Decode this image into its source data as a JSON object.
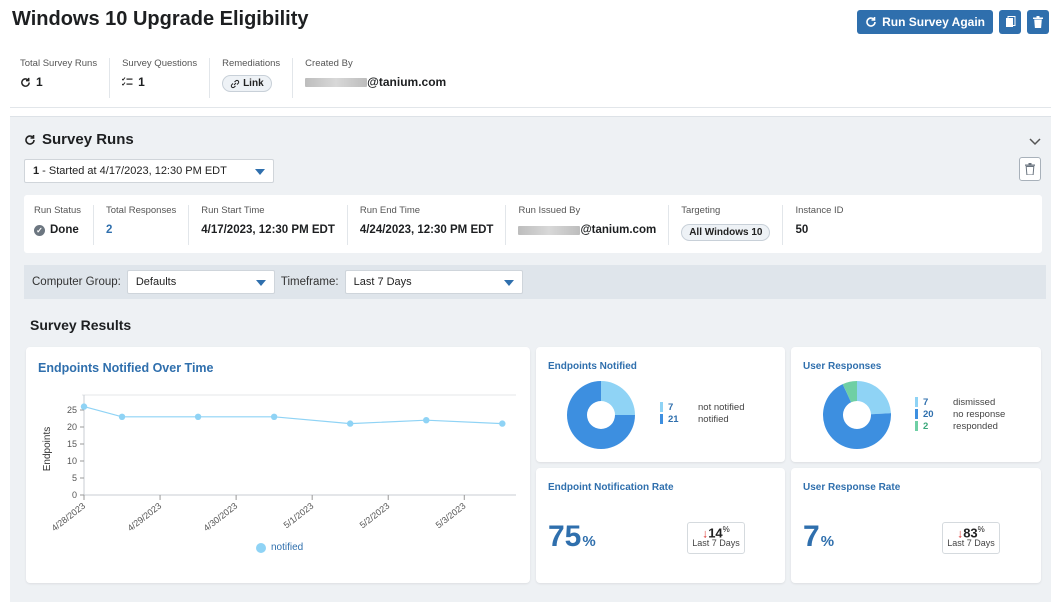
{
  "header": {
    "title": "Windows 10 Upgrade Eligibility",
    "run_again_label": "Run Survey Again",
    "meta": {
      "total_runs_label": "Total Survey Runs",
      "total_runs_value": "1",
      "questions_label": "Survey Questions",
      "questions_value": "1",
      "remediations_label": "Remediations",
      "remediations_link": "Link",
      "created_by_label": "Created By",
      "created_by_value": "@tanium.com"
    }
  },
  "survey_runs": {
    "title": "Survey Runs",
    "selected_run_number": "1",
    "selected_run_text": " - Started at 4/17/2023, 12:30 PM EDT",
    "info": {
      "run_status_label": "Run Status",
      "run_status_value": "Done",
      "total_responses_label": "Total Responses",
      "total_responses_value": "2",
      "start_label": "Run Start Time",
      "start_value": "4/17/2023, 12:30 PM EDT",
      "end_label": "Run End Time",
      "end_value": "4/24/2023, 12:30 PM EDT",
      "issued_by_label": "Run Issued By",
      "issued_by_value": "@tanium.com",
      "targeting_label": "Targeting",
      "targeting_value": "All Windows 10",
      "instance_label": "Instance ID",
      "instance_value": "50"
    },
    "filters": {
      "group_label": "Computer Group:",
      "group_value": "Defaults",
      "timeframe_label": "Timeframe:",
      "timeframe_value": "Last 7 Days"
    }
  },
  "results": {
    "title": "Survey Results",
    "endpoints_over_time_title": "Endpoints Notified Over Time",
    "endpoints_notified": {
      "title": "Endpoints Notified",
      "legend": [
        {
          "num": "7",
          "label": "not notified",
          "color": "#8fd3f5"
        },
        {
          "num": "21",
          "label": "notified",
          "color": "#3d8fe0"
        }
      ]
    },
    "user_responses": {
      "title": "User Responses",
      "legend": [
        {
          "num": "7",
          "label": "dismissed",
          "color": "#8fd3f5"
        },
        {
          "num": "20",
          "label": "no response",
          "color": "#3d8fe0"
        },
        {
          "num": "2",
          "label": "responded",
          "color": "#6fcfa5"
        }
      ]
    },
    "notification_rate": {
      "title": "Endpoint Notification Rate",
      "value": "75",
      "unit": "%",
      "delta": "14",
      "delta_unit": "%",
      "delta_label": "Last 7 Days"
    },
    "response_rate": {
      "title": "User Response Rate",
      "value": "7",
      "unit": "%",
      "delta": "83",
      "delta_unit": "%",
      "delta_label": "Last 7 Days"
    }
  },
  "chart_data": [
    {
      "type": "line",
      "title": "Endpoints Notified Over Time",
      "ylabel": "Endpoints",
      "xlabel": "",
      "x": [
        "4/28/2023",
        "4/29/2023",
        "4/30/2023",
        "5/1/2023",
        "5/2/2023",
        "5/3/2023"
      ],
      "yticks": [
        0,
        5,
        10,
        15,
        20,
        25
      ],
      "ylim": [
        0,
        30
      ],
      "series": [
        {
          "name": "notified",
          "color": "#8fd3f5",
          "points": [
            {
              "x": "4/28/2023",
              "y": 26
            },
            {
              "x": "4/28/2023 12:00",
              "y": 23
            },
            {
              "x": "4/29/2023 12:00",
              "y": 23
            },
            {
              "x": "4/30/2023 12:00",
              "y": 23
            },
            {
              "x": "5/1/2023 12:00",
              "y": 21
            },
            {
              "x": "5/2/2023 12:00",
              "y": 22
            },
            {
              "x": "5/3/2023 12:00",
              "y": 21
            }
          ]
        }
      ]
    },
    {
      "type": "pie",
      "title": "Endpoints Notified",
      "slices": [
        {
          "label": "not notified",
          "value": 7,
          "color": "#8fd3f5"
        },
        {
          "label": "notified",
          "value": 21,
          "color": "#3d8fe0"
        }
      ]
    },
    {
      "type": "pie",
      "title": "User Responses",
      "slices": [
        {
          "label": "dismissed",
          "value": 7,
          "color": "#8fd3f5"
        },
        {
          "label": "no response",
          "value": 20,
          "color": "#3d8fe0"
        },
        {
          "label": "responded",
          "value": 2,
          "color": "#6fcfa5"
        }
      ]
    }
  ]
}
